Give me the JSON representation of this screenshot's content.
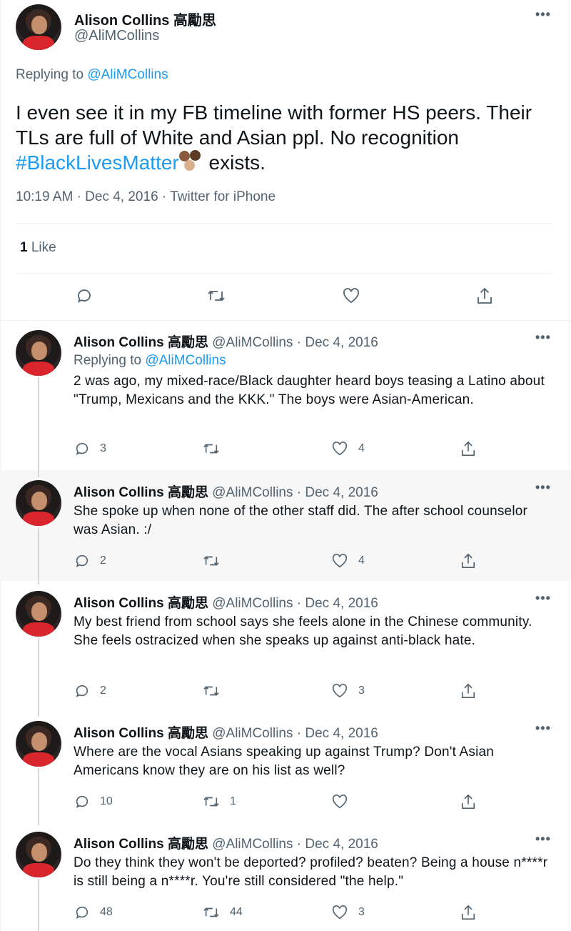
{
  "main_tweet": {
    "author_name": "Alison Collins 高勵思",
    "author_handle": "@AliMCollins",
    "replying_prefix": "Replying to ",
    "replying_to": "@AliMCollins",
    "text_part1": "I even see it in my FB timeline with former HS peers. Their TLs are full of White and Asian ppl. No recognition ",
    "hashtag": "#BlackLivesMatter",
    "text_part2": " exists.",
    "time": "10:19 AM",
    "date": "Dec 4, 2016",
    "source": "Twitter for iPhone",
    "sep": "·",
    "like_count": "1",
    "like_label": "Like",
    "more": "•••"
  },
  "replies": [
    {
      "name": "Alison Collins 高勵思",
      "handle": "@AliMCollins",
      "date": "Dec 4, 2016",
      "replying_prefix": "Replying to ",
      "replying_to": "@AliMCollins",
      "text": "2 was ago, my mixed-race/Black daughter heard boys teasing a Latino about \"Trump, Mexicans and the KKK.\" The boys were Asian-American.",
      "replies": "3",
      "retweets": "",
      "likes": "4"
    },
    {
      "name": "Alison Collins 高勵思",
      "handle": "@AliMCollins",
      "date": "Dec 4, 2016",
      "text": "She spoke up when none of the other staff did. The after school counselor was Asian. :/",
      "replies": "2",
      "retweets": "",
      "likes": "4"
    },
    {
      "name": "Alison Collins 高勵思",
      "handle": "@AliMCollins",
      "date": "Dec 4, 2016",
      "text": "My best friend from school says she feels alone in the Chinese community. She feels ostracized when she speaks up against anti-black hate.",
      "replies": "2",
      "retweets": "",
      "likes": "3"
    },
    {
      "name": "Alison Collins 高勵思",
      "handle": "@AliMCollins",
      "date": "Dec 4, 2016",
      "text": "Where are the vocal Asians speaking up against Trump? Don't Asian Americans know they are on his list as well?",
      "replies": "10",
      "retweets": "1",
      "likes": ""
    },
    {
      "name": "Alison Collins 高勵思",
      "handle": "@AliMCollins",
      "date": "Dec 4, 2016",
      "text": "Do they think they won't be deported? profiled? beaten? Being a house n****r is still being a n****r. You're still considered \"the help.\"",
      "replies": "48",
      "retweets": "44",
      "likes": "3"
    }
  ],
  "colors": {
    "link": "#1d9bf0",
    "secondary_text": "#536471",
    "highlight_bg": "#f7f7f7"
  }
}
